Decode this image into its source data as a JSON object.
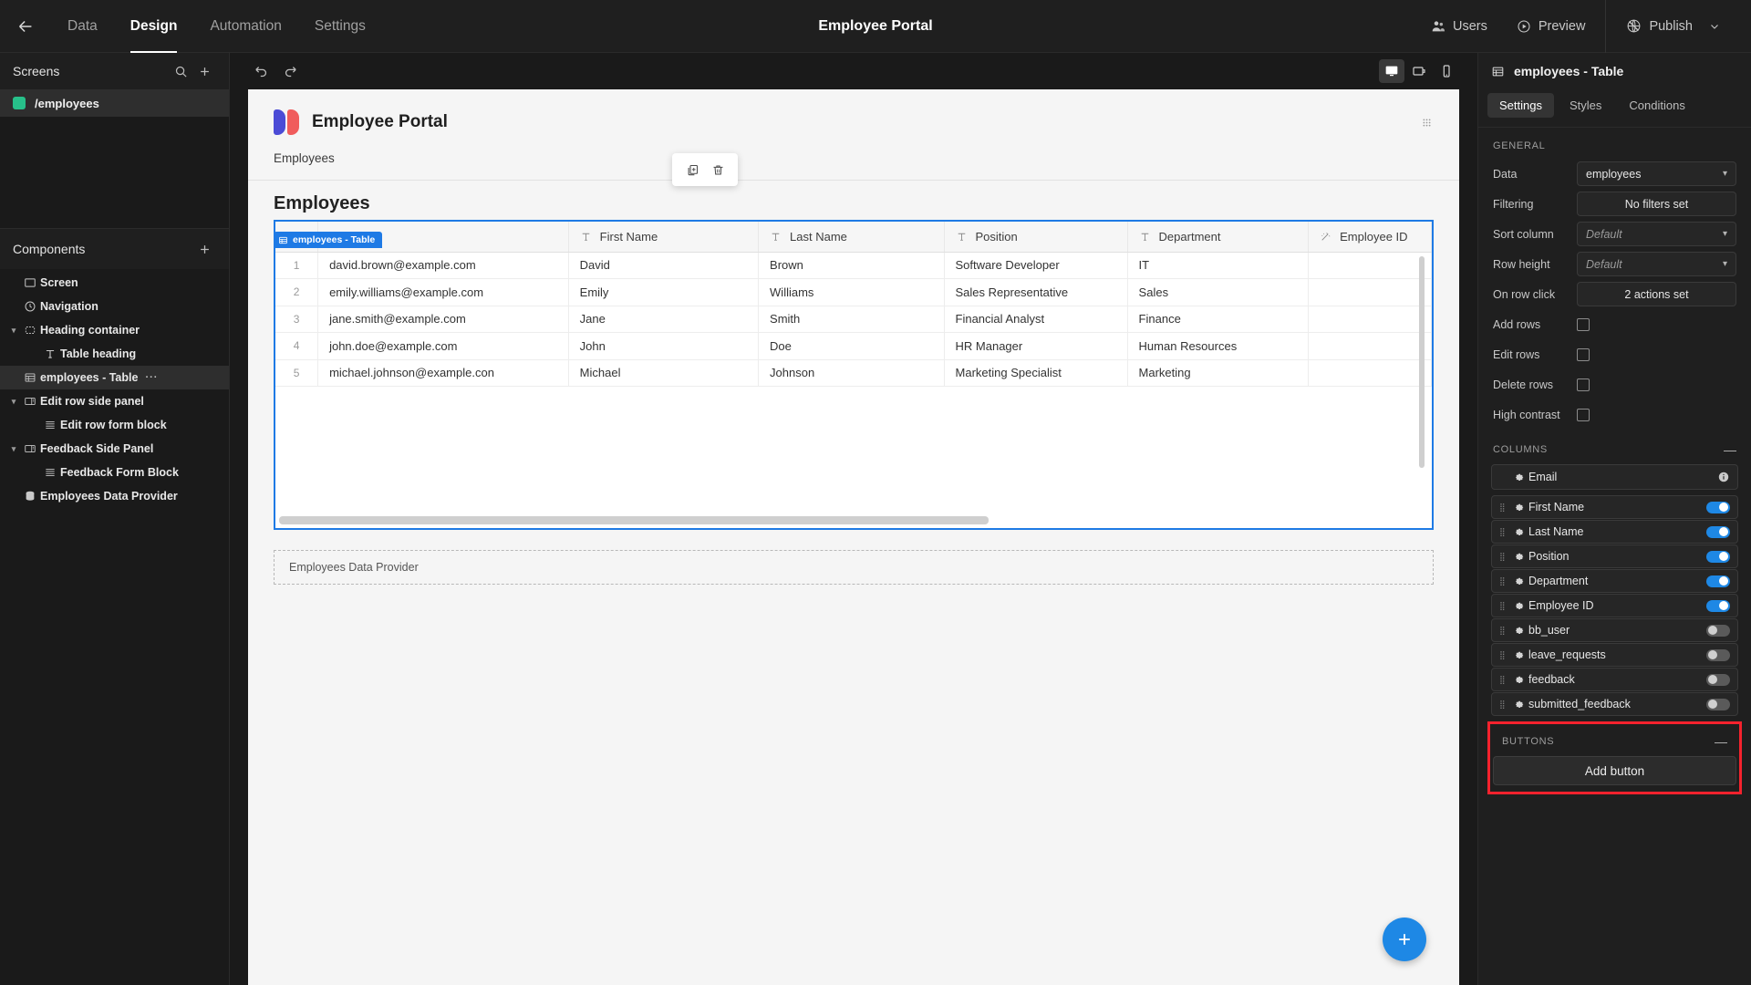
{
  "topbar": {
    "back_icon": "arrow-left-icon",
    "tabs": [
      {
        "label": "Data",
        "active": false
      },
      {
        "label": "Design",
        "active": true
      },
      {
        "label": "Automation",
        "active": false
      },
      {
        "label": "Settings",
        "active": false
      }
    ],
    "title": "Employee Portal",
    "users_label": "Users",
    "preview_label": "Preview",
    "publish_label": "Publish"
  },
  "screens_panel": {
    "title": "Screens",
    "search_icon": "search-icon",
    "add_icon": "plus-icon",
    "items": [
      {
        "label": "/employees",
        "color": "#27c08a",
        "selected": true
      }
    ]
  },
  "components_panel": {
    "title": "Components",
    "add_icon": "plus-icon",
    "items": [
      {
        "label": "Screen",
        "icon": "screen-icon",
        "depth": 0,
        "caret": "",
        "selected": false
      },
      {
        "label": "Navigation",
        "icon": "navigation-icon",
        "depth": 0,
        "caret": "",
        "selected": false
      },
      {
        "label": "Heading container",
        "icon": "container-icon",
        "depth": 0,
        "caret": "down",
        "selected": false
      },
      {
        "label": "Table heading",
        "icon": "text-icon",
        "depth": 1,
        "caret": "",
        "selected": false
      },
      {
        "label": "employees - Table",
        "icon": "table-icon",
        "depth": 0,
        "caret": "",
        "selected": true,
        "menu": "···"
      },
      {
        "label": "Edit row side panel",
        "icon": "side-panel-icon",
        "depth": 0,
        "caret": "down",
        "selected": false
      },
      {
        "label": "Edit row form block",
        "icon": "form-icon",
        "depth": 1,
        "caret": "",
        "selected": false
      },
      {
        "label": "Feedback Side Panel",
        "icon": "side-panel-icon",
        "depth": 0,
        "caret": "down",
        "selected": false
      },
      {
        "label": "Feedback Form Block",
        "icon": "form-icon",
        "depth": 1,
        "caret": "",
        "selected": false
      },
      {
        "label": "Employees Data Provider",
        "icon": "database-icon",
        "depth": 0,
        "caret": "",
        "selected": false
      }
    ]
  },
  "canvas_toolbar": {
    "undo_icon": "undo-icon",
    "redo_icon": "redo-icon",
    "devices": [
      {
        "name": "desktop-icon",
        "active": true
      },
      {
        "name": "tablet-icon",
        "active": false
      },
      {
        "name": "mobile-icon",
        "active": false
      }
    ]
  },
  "canvas": {
    "app_title": "Employee Portal",
    "nav_link": "Employees",
    "grid_handle_icon": "grid-handle-icon",
    "table_heading": "Employees",
    "selection_badge": "employees - Table",
    "float_toolbar": [
      {
        "name": "duplicate-icon"
      },
      {
        "name": "delete-icon"
      }
    ],
    "table": {
      "columns": [
        {
          "label": "Email",
          "type_icon": "text-type-icon"
        },
        {
          "label": "First Name",
          "type_icon": "text-type-icon"
        },
        {
          "label": "Last Name",
          "type_icon": "text-type-icon"
        },
        {
          "label": "Position",
          "type_icon": "text-type-icon"
        },
        {
          "label": "Department",
          "type_icon": "text-type-icon"
        },
        {
          "label": "Employee ID",
          "type_icon": "formula-type-icon"
        }
      ],
      "rows": [
        {
          "index": "1",
          "Email": "david.brown@example.com",
          "First Name": "David",
          "Last Name": "Brown",
          "Position": "Software Developer",
          "Department": "IT",
          "Employee ID": ""
        },
        {
          "index": "2",
          "Email": "emily.williams@example.com",
          "First Name": "Emily",
          "Last Name": "Williams",
          "Position": "Sales Representative",
          "Department": "Sales",
          "Employee ID": ""
        },
        {
          "index": "3",
          "Email": "jane.smith@example.com",
          "First Name": "Jane",
          "Last Name": "Smith",
          "Position": "Financial Analyst",
          "Department": "Finance",
          "Employee ID": ""
        },
        {
          "index": "4",
          "Email": "john.doe@example.com",
          "First Name": "John",
          "Last Name": "Doe",
          "Position": "HR Manager",
          "Department": "Human Resources",
          "Employee ID": ""
        },
        {
          "index": "5",
          "Email": "michael.johnson@example.con",
          "First Name": "Michael",
          "Last Name": "Johnson",
          "Position": "Marketing Specialist",
          "Department": "Marketing",
          "Employee ID": ""
        }
      ]
    },
    "data_provider_label": "Employees Data Provider",
    "fab_icon": "plus-icon"
  },
  "properties": {
    "component_title": "employees - Table",
    "component_icon": "table-icon",
    "tabs": [
      {
        "label": "Settings",
        "active": true
      },
      {
        "label": "Styles",
        "active": false
      },
      {
        "label": "Conditions",
        "active": false
      }
    ],
    "general": {
      "title": "GENERAL",
      "fields": [
        {
          "label": "Data",
          "value": "employees",
          "control": "select"
        },
        {
          "label": "Filtering",
          "value": "No filters set",
          "control": "button"
        },
        {
          "label": "Sort column",
          "value": "Default",
          "control": "select",
          "placeholder": true
        },
        {
          "label": "Row height",
          "value": "Default",
          "control": "select",
          "placeholder": true
        },
        {
          "label": "On row click",
          "value": "2 actions set",
          "control": "button"
        },
        {
          "label": "Add rows",
          "value": "",
          "control": "checkbox",
          "checked": false
        },
        {
          "label": "Edit rows",
          "value": "",
          "control": "checkbox",
          "checked": false
        },
        {
          "label": "Delete rows",
          "value": "",
          "control": "checkbox",
          "checked": false
        },
        {
          "label": "High contrast",
          "value": "",
          "control": "checkbox",
          "checked": false
        }
      ]
    },
    "columns_section": {
      "title": "COLUMNS",
      "collapse_icon": "minus-icon",
      "primary": {
        "label": "Email",
        "gear_icon": "gear-icon",
        "info_icon": "info-icon"
      },
      "items": [
        {
          "label": "First Name",
          "enabled": true
        },
        {
          "label": "Last Name",
          "enabled": true
        },
        {
          "label": "Position",
          "enabled": true
        },
        {
          "label": "Department",
          "enabled": true
        },
        {
          "label": "Employee ID",
          "enabled": true
        },
        {
          "label": "bb_user",
          "enabled": false
        },
        {
          "label": "leave_requests",
          "enabled": false
        },
        {
          "label": "feedback",
          "enabled": false
        },
        {
          "label": "submitted_feedback",
          "enabled": false
        }
      ]
    },
    "buttons_section": {
      "title": "BUTTONS",
      "collapse_icon": "minus-icon",
      "add_button_label": "Add button",
      "highlight_color": "#f5222d"
    }
  }
}
